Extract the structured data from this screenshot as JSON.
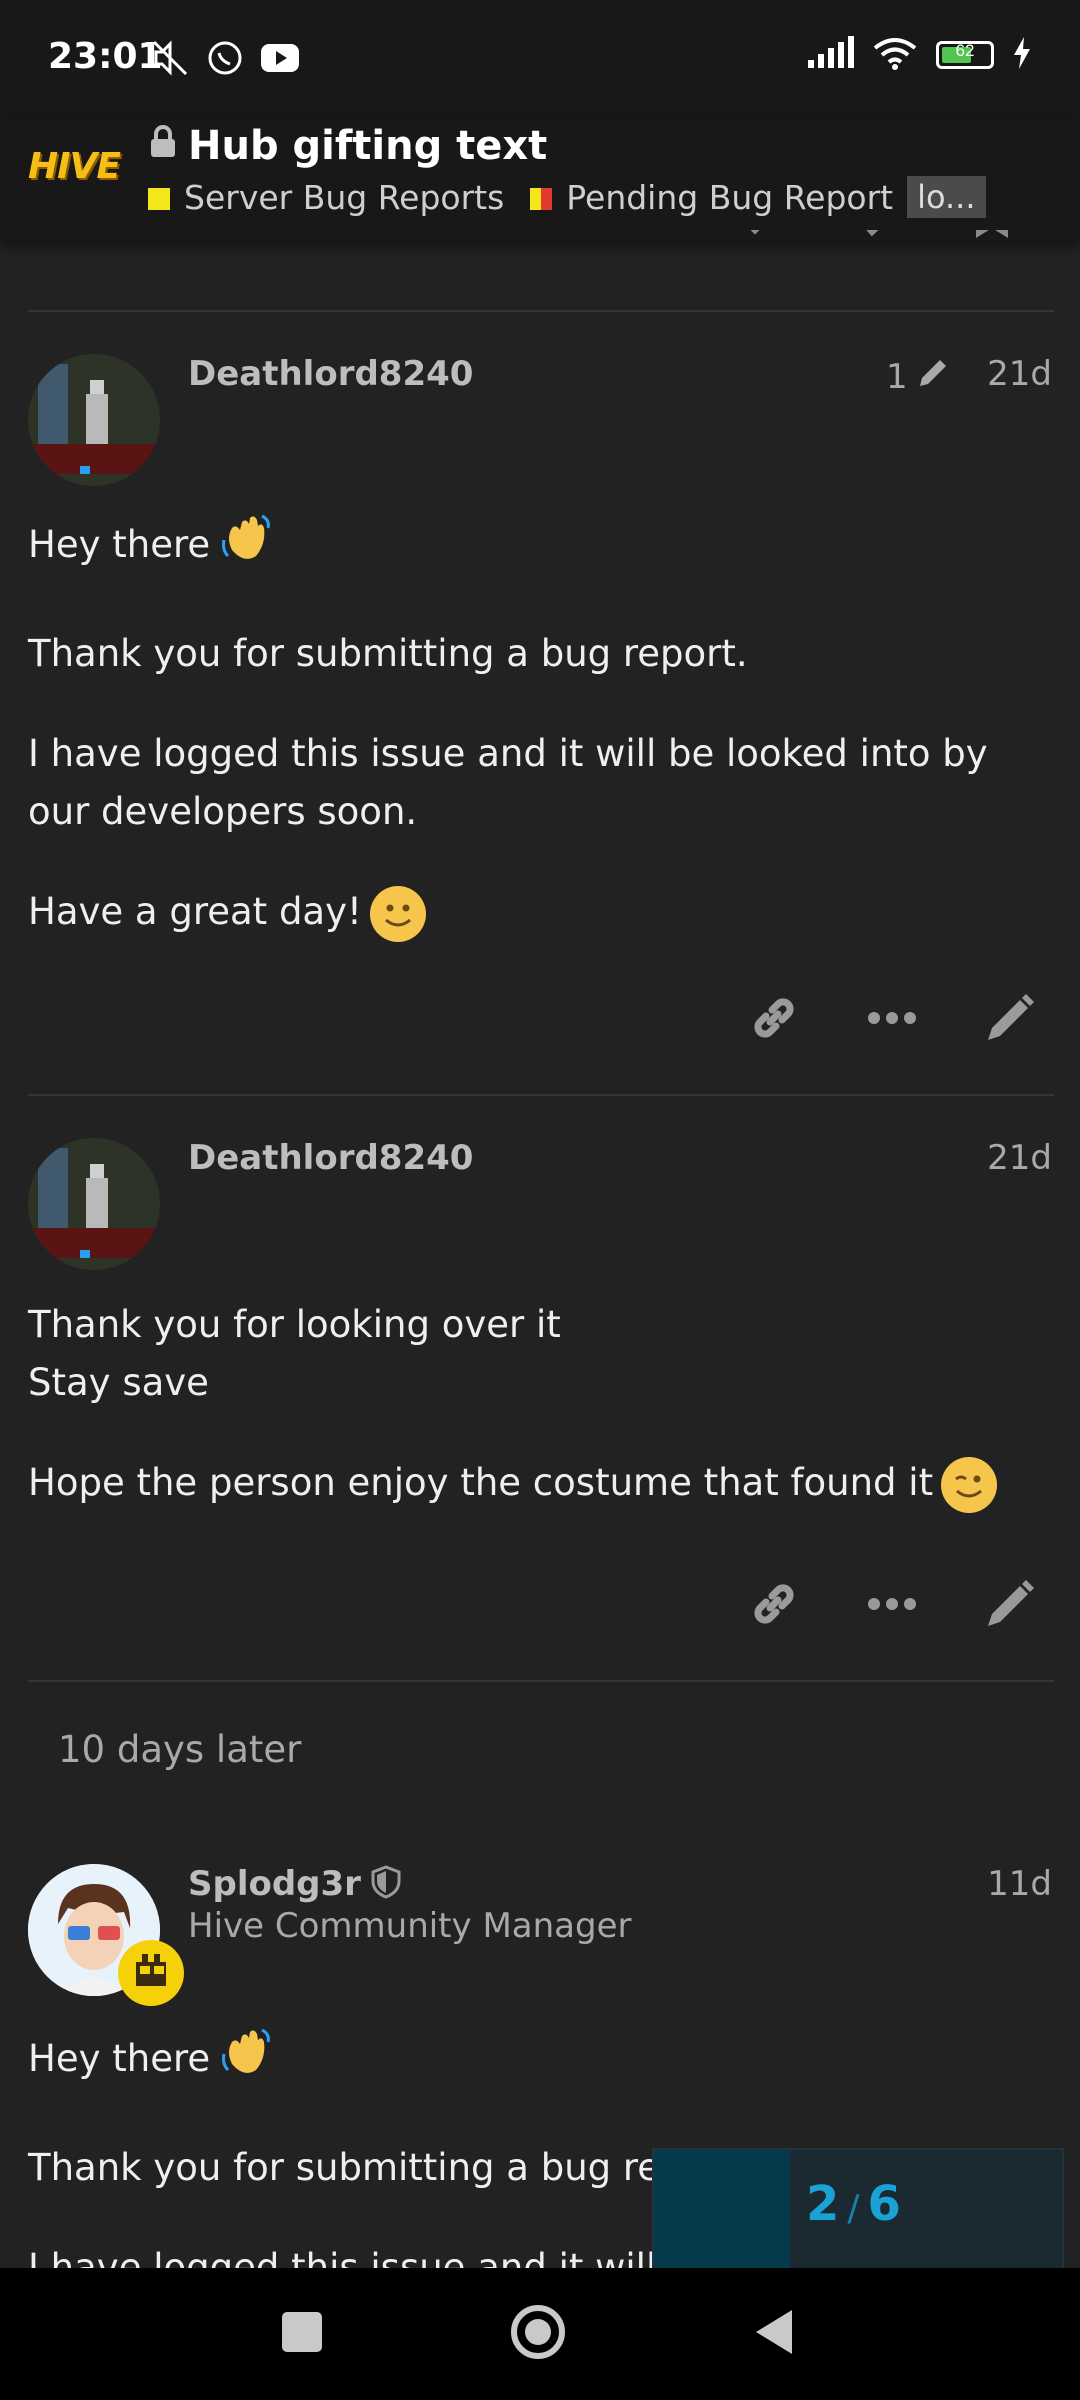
{
  "status_bar": {
    "time": "23:01",
    "battery": "62",
    "battery_fraction": 0.62
  },
  "header": {
    "logo_text": "HIVE",
    "title": "Hub gifting text",
    "category": "Server Bug Reports",
    "category_color": "#f5e51b",
    "subcategory": "Pending Bug Report",
    "subcategory_colors": [
      "#f5e51b",
      "#e23b2e"
    ],
    "tag": "lo..."
  },
  "posts": [
    {
      "username": "Deathlord8240",
      "edit_count": "1",
      "date": "21d",
      "lines": [
        "Hey there",
        "Thank you for submitting a bug report.",
        "I have logged this issue and it will be looked into by our developers soon.",
        "Have a great day!"
      ]
    },
    {
      "username": "Deathlord8240",
      "date": "21d",
      "lines": [
        "Thank you for looking over it",
        "Stay save",
        "Hope the person enjoy the costume that found it"
      ]
    },
    {
      "username": "Splodg3r",
      "user_title": "Hive Community Manager",
      "date": "11d",
      "lines": [
        "Hey there",
        "Thank you for submitting a bug report.",
        "I have logged this issue and it will"
      ]
    }
  ],
  "time_gap": "10 days later",
  "progress": {
    "current": "2",
    "separator": "/",
    "total": "6",
    "fraction": 0.333
  },
  "accent_color": "#1aa2d6"
}
